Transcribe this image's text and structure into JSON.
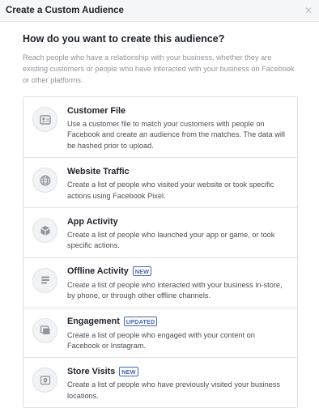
{
  "dialog": {
    "title": "Create a Custom Audience",
    "close_icon": "close-icon",
    "question": "How do you want to create this audience?",
    "intro": "Reach people who have a relationship with your business, whether they are existing customers or people who have interacted with your business on Facebook or other platforms."
  },
  "options": [
    {
      "title": "Customer File",
      "badge": "",
      "description": "Use a customer file to match your customers with people on Facebook and create an audience from the matches. The data will be hashed prior to upload.",
      "icon": "customer-file-icon"
    },
    {
      "title": "Website Traffic",
      "badge": "",
      "description": "Create a list of people who visited your website or took specific actions using Facebook Pixel.",
      "icon": "globe-icon"
    },
    {
      "title": "App Activity",
      "badge": "",
      "description": "Create a list of people who launched your app or game, or took specific actions.",
      "icon": "app-cube-icon"
    },
    {
      "title": "Offline Activity",
      "badge": "NEW",
      "description": "Create a list of people who interacted with your business in-store, by phone, or through other offline channels.",
      "icon": "offline-list-icon"
    },
    {
      "title": "Engagement",
      "badge": "UPDATED",
      "description": "Create a list of people who engaged with your content on Facebook or Instagram.",
      "icon": "engagement-icon"
    },
    {
      "title": "Store Visits",
      "badge": "NEW",
      "description": "Create a list of people who have previously visited your business locations.",
      "icon": "store-location-icon"
    }
  ],
  "colors": {
    "accent": "#4267b2",
    "icon": "#90949c"
  }
}
